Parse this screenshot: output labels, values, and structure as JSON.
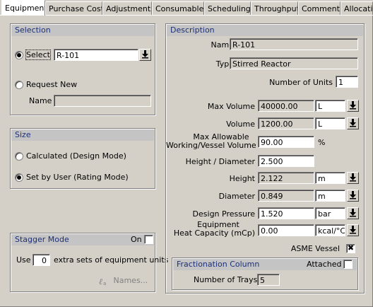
{
  "tabs": [
    {
      "label": "Equipment",
      "active": true
    },
    {
      "label": "Purchase Cost"
    },
    {
      "label": "Adjustments"
    },
    {
      "label": "Consumables"
    },
    {
      "label": "Scheduling"
    },
    {
      "label": "Throughput"
    },
    {
      "label": "Comments"
    },
    {
      "label": "Allocatio"
    }
  ],
  "selection": {
    "title": "Selection",
    "select_label": "Select",
    "select_value": "R-101",
    "request_new_label": "Request New",
    "name_label": "Name",
    "name_value": "",
    "selected_option": "select"
  },
  "size": {
    "title": "Size",
    "calculated_label": "Calculated (Design Mode)",
    "set_by_user_label": "Set by User (Rating Mode)",
    "selected_option": "set_by_user"
  },
  "stagger": {
    "title": "Stagger Mode",
    "on_label": "On",
    "on_checked": false,
    "use_label": "Use",
    "count": "0",
    "extra_label": "extra sets of equipment units",
    "names_label": "Names..."
  },
  "description": {
    "title": "Description",
    "name_label": "Name",
    "name_value": "R-101",
    "type_label": "Type",
    "type_value": "Stirred Reactor",
    "units_label": "Number of Units",
    "units_value": "1",
    "max_volume_label": "Max Volume",
    "max_volume_value": "40000.00",
    "max_volume_unit": "L",
    "volume_label": "Volume",
    "volume_value": "1200.00",
    "volume_unit": "L",
    "max_allow_label_1": "Max Allowable",
    "max_allow_label_2": "Working/Vessel Volume",
    "max_allow_value": "90.00",
    "max_allow_unit": "%",
    "hd_label": "Height / Diameter",
    "hd_value": "2.500",
    "height_label": "Height",
    "height_value": "2.122",
    "height_unit": "m",
    "diameter_label": "Diameter",
    "diameter_value": "0.849",
    "diameter_unit": "m",
    "pressure_label": "Design Pressure",
    "pressure_value": "1.520",
    "pressure_unit": "bar",
    "heatcap_label_1": "Equipment",
    "heatcap_label_2": "Heat Capacity (mCp)",
    "heatcap_value": "0.00",
    "heatcap_unit": "kcal/°C",
    "asme_label": "ASME Vessel",
    "asme_checked": true
  },
  "fractionation": {
    "title": "Fractionation Column",
    "attached_label": "Attached",
    "attached_checked": false,
    "trays_label": "Number of Trays",
    "trays_value": "5"
  },
  "icons": {
    "dropdown": "down-arrow-bar-icon",
    "names": "edit-label-icon",
    "check": "✖"
  }
}
